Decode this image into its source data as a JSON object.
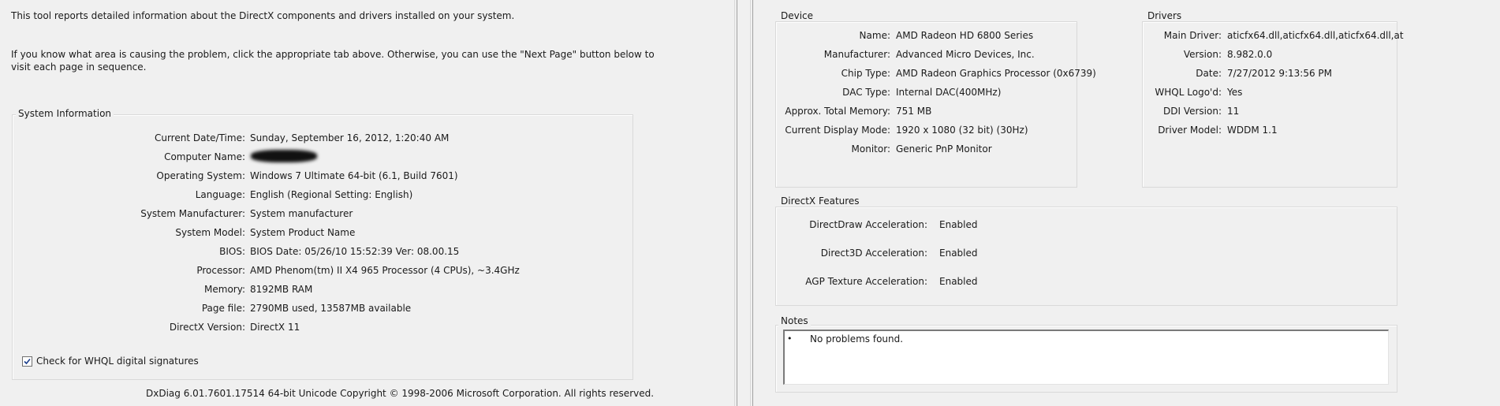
{
  "intro": {
    "line1": "This tool reports detailed information about the DirectX components and drivers installed on your system.",
    "line2": "If you know what area is causing the problem, click the appropriate tab above.  Otherwise, you can use the \"Next Page\" button below to",
    "line3": "visit each page in sequence."
  },
  "system_info": {
    "title": "System Information",
    "rows": [
      {
        "label": "Current Date/Time:",
        "value": "Sunday, September 16, 2012, 1:20:40 AM"
      },
      {
        "label": "Computer Name:",
        "value": ""
      },
      {
        "label": "Operating System:",
        "value": "Windows 7 Ultimate 64-bit (6.1, Build 7601)"
      },
      {
        "label": "Language:",
        "value": "English (Regional Setting: English)"
      },
      {
        "label": "System Manufacturer:",
        "value": "System manufacturer"
      },
      {
        "label": "System Model:",
        "value": "System Product Name"
      },
      {
        "label": "BIOS:",
        "value": "BIOS Date: 05/26/10 15:52:39 Ver: 08.00.15"
      },
      {
        "label": "Processor:",
        "value": "AMD Phenom(tm) II X4 965 Processor (4 CPUs), ~3.4GHz"
      },
      {
        "label": "Memory:",
        "value": "8192MB RAM"
      },
      {
        "label": "Page file:",
        "value": "2790MB used, 13587MB available"
      },
      {
        "label": "DirectX Version:",
        "value": "DirectX 11"
      }
    ],
    "whql_label": "Check for WHQL digital signatures",
    "whql_checked": true
  },
  "footer": "DxDiag 6.01.7601.17514 64-bit Unicode  Copyright © 1998-2006 Microsoft Corporation.  All rights reserved.",
  "device": {
    "title": "Device",
    "rows": [
      {
        "label": "Name:",
        "value": "AMD Radeon HD 6800 Series"
      },
      {
        "label": "Manufacturer:",
        "value": "Advanced Micro Devices, Inc."
      },
      {
        "label": "Chip Type:",
        "value": "AMD Radeon Graphics Processor (0x6739)"
      },
      {
        "label": "DAC Type:",
        "value": "Internal DAC(400MHz)"
      },
      {
        "label": "Approx. Total Memory:",
        "value": "751 MB"
      },
      {
        "label": "Current Display Mode:",
        "value": "1920 x 1080 (32 bit) (30Hz)"
      },
      {
        "label": "Monitor:",
        "value": "Generic PnP Monitor"
      }
    ]
  },
  "drivers": {
    "title": "Drivers",
    "rows": [
      {
        "label": "Main Driver:",
        "value": "aticfx64.dll,aticfx64.dll,aticfx64.dll,at"
      },
      {
        "label": "Version:",
        "value": "8.982.0.0"
      },
      {
        "label": "Date:",
        "value": "7/27/2012 9:13:56 PM"
      },
      {
        "label": "WHQL Logo'd:",
        "value": "Yes"
      },
      {
        "label": "DDI Version:",
        "value": "11"
      },
      {
        "label": "Driver Model:",
        "value": "WDDM 1.1"
      }
    ]
  },
  "features": {
    "title": "DirectX Features",
    "rows": [
      {
        "label": "DirectDraw Acceleration:",
        "value": "Enabled"
      },
      {
        "label": "Direct3D Acceleration:",
        "value": "Enabled"
      },
      {
        "label": "AGP Texture Acceleration:",
        "value": "Enabled"
      }
    ]
  },
  "notes": {
    "title": "Notes",
    "items": [
      "No problems found."
    ]
  }
}
